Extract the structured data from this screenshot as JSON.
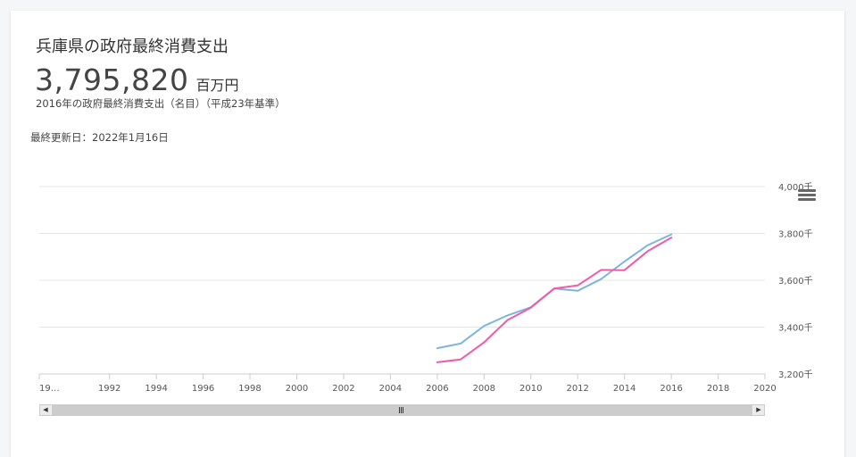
{
  "card": {
    "title": "兵庫県の政府最終消費支出",
    "value": "3,795,820",
    "unit": "百万円",
    "subtitle": "2016年の政府最終消費支出（名目）（平成23年基準）",
    "updated": "最終更新日：2022年1月16日"
  },
  "icons": {
    "menu": "hamburger-menu-icon",
    "scroll_left": "arrow-left-icon",
    "scroll_right": "arrow-right-icon"
  },
  "colors": {
    "series_blue": "#7cb5e2",
    "series_pink": "#f25aa8",
    "grid": "#e6e6e6",
    "axis": "#cccccc"
  },
  "chart_data": {
    "type": "line",
    "title": "",
    "xlabel": "",
    "ylabel": "",
    "xlim": [
      1989,
      2020
    ],
    "ylim": [
      3200,
      4000
    ],
    "x_tick_labels": [
      "19…",
      "1992",
      "1994",
      "1996",
      "1998",
      "2000",
      "2002",
      "2004",
      "2006",
      "2008",
      "2010",
      "2012",
      "2014",
      "2016",
      "2018",
      "2020"
    ],
    "y_tick_labels": [
      "4,000千",
      "3,800千",
      "3,600千",
      "3,400千",
      "3,200千"
    ],
    "x_ticks": [
      1989,
      1992,
      1994,
      1996,
      1998,
      2000,
      2002,
      2004,
      2006,
      2008,
      2010,
      2012,
      2014,
      2016,
      2018,
      2020
    ],
    "y_ticks": [
      4000,
      3800,
      3600,
      3400,
      3200
    ],
    "grid": true,
    "legend": "none",
    "series": [
      {
        "color": "#7cb5e2",
        "x": [
          2006,
          2007,
          2008,
          2009,
          2010,
          2011,
          2012,
          2013,
          2014,
          2015,
          2016
        ],
        "values": [
          3310,
          3330,
          3405,
          3450,
          3485,
          3565,
          3555,
          3605,
          3680,
          3750,
          3796
        ]
      },
      {
        "color": "#f25aa8",
        "x": [
          2006,
          2007,
          2008,
          2009,
          2010,
          2011,
          2012,
          2013,
          2014,
          2015,
          2016
        ],
        "values": [
          3250,
          3262,
          3335,
          3430,
          3483,
          3565,
          3578,
          3644,
          3643,
          3725,
          3782
        ]
      }
    ]
  }
}
